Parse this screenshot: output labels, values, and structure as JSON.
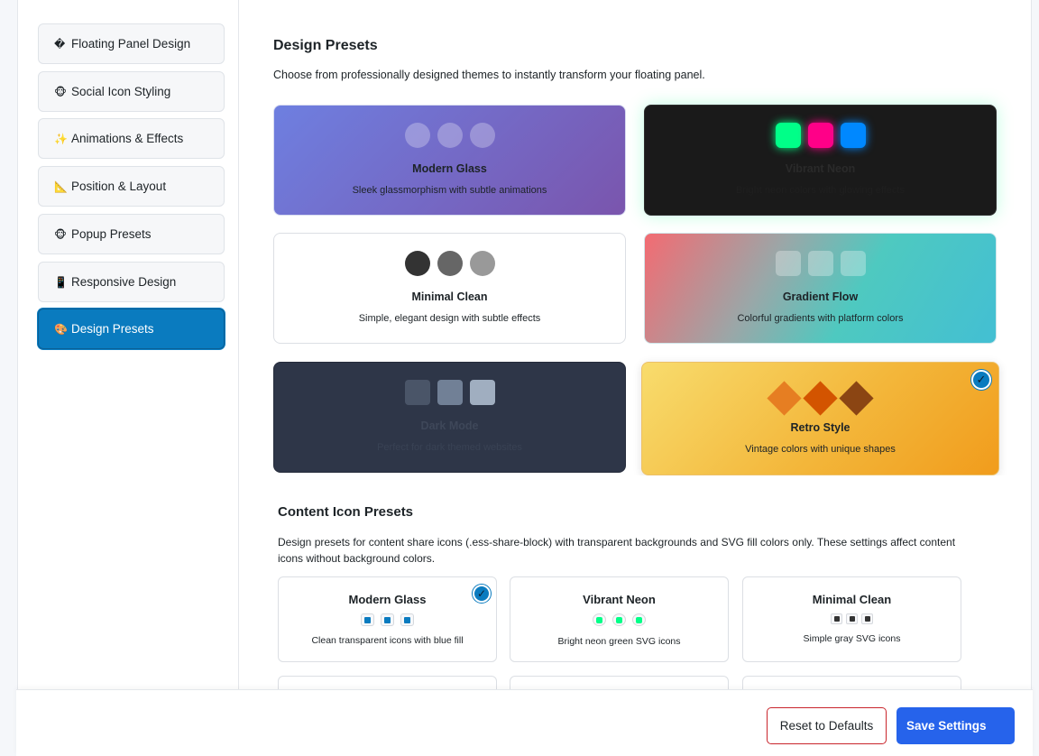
{
  "sidebar": {
    "items": [
      {
        "icon": "�",
        "label": "Floating Panel Design"
      },
      {
        "icon": "🐵",
        "label": "Social Icon Styling"
      },
      {
        "icon": "✨",
        "label": "Animations & Effects"
      },
      {
        "icon": "📐",
        "label": "Position & Layout"
      },
      {
        "icon": "🐵",
        "label": "Popup Presets"
      },
      {
        "icon": "📱",
        "label": "Responsive Design"
      },
      {
        "icon": "🎨",
        "label": "Design Presets",
        "active": true
      }
    ]
  },
  "design_presets": {
    "title": "Design Presets",
    "description": "Choose from professionally designed themes to instantly transform your floating panel.",
    "presets": [
      {
        "name": "Modern Glass",
        "description": "Sleek glassmorphism with subtle animations"
      },
      {
        "name": "Vibrant Neon",
        "description": "Bright neon colors with glowing effects",
        "colors": [
          "#00ff88",
          "#ff0088",
          "#0088ff"
        ]
      },
      {
        "name": "Minimal Clean",
        "description": "Simple, elegant design with subtle effects",
        "colors": [
          "#333333",
          "#666666",
          "#999999"
        ]
      },
      {
        "name": "Gradient Flow",
        "description": "Colorful gradients with platform colors"
      },
      {
        "name": "Dark Mode",
        "description": "Perfect for dark themed websites",
        "colors": [
          "#4a5568",
          "#718096",
          "#a0aec0"
        ]
      },
      {
        "name": "Retro Style",
        "description": "Vintage colors with unique shapes",
        "colors": [
          "#e67e22",
          "#d35400",
          "#8b4513"
        ],
        "selected": true
      }
    ]
  },
  "content_presets": {
    "title": "Content Icon Presets",
    "description": "Design presets for content share icons (.ess-share-block) with transparent backgrounds and SVG fill colors only. These settings affect content icons without background colors.",
    "presets": [
      {
        "name": "Modern Glass",
        "description": "Clean transparent icons with blue fill",
        "color": "#0a7bbf",
        "selected": true
      },
      {
        "name": "Vibrant Neon",
        "description": "Bright neon green SVG icons",
        "color": "#00ff88"
      },
      {
        "name": "Minimal Clean",
        "description": "Simple gray SVG icons",
        "color": "#333333"
      }
    ]
  },
  "check_mark": "✓",
  "footer": {
    "reset_label": "Reset to Defaults",
    "save_label": "Save Settings"
  }
}
